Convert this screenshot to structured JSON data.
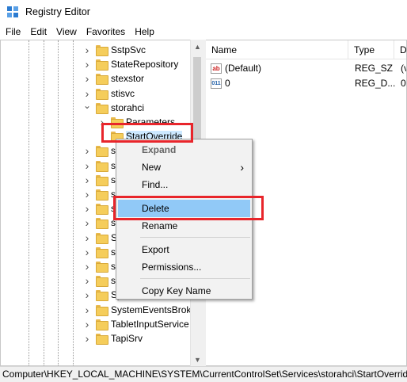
{
  "window": {
    "title": "Registry Editor"
  },
  "menu": [
    "File",
    "Edit",
    "View",
    "Favorites",
    "Help"
  ],
  "tree": {
    "items": [
      {
        "label": "SstpSvc",
        "expander": "right"
      },
      {
        "label": "StateRepository",
        "expander": "right"
      },
      {
        "label": "stexstor",
        "expander": "right"
      },
      {
        "label": "stisvc",
        "expander": "right"
      },
      {
        "label": "storahci",
        "expander": "down"
      },
      {
        "label": "Parameters",
        "expander": "right",
        "child": true
      },
      {
        "label": "StartOverride",
        "expander": "",
        "child": true,
        "selected": true
      },
      {
        "label": "s",
        "expander": "right"
      },
      {
        "label": "s",
        "expander": "right"
      },
      {
        "label": "s",
        "expander": "right"
      },
      {
        "label": "s",
        "expander": "right"
      },
      {
        "label": "s",
        "expander": "right"
      },
      {
        "label": "s",
        "expander": "right"
      },
      {
        "label": "S",
        "expander": "right"
      },
      {
        "label": "s",
        "expander": "right"
      },
      {
        "label": "s",
        "expander": "right"
      },
      {
        "label": "s",
        "expander": "right"
      },
      {
        "label": "SysMain",
        "expander": "right"
      },
      {
        "label": "SystemEventsBrok",
        "expander": "right"
      },
      {
        "label": "TabletInputService",
        "expander": "right"
      },
      {
        "label": "TapiSrv",
        "expander": "right"
      }
    ]
  },
  "list": {
    "columns": [
      "Name",
      "Type",
      "D"
    ],
    "rows": [
      {
        "icon": "ab",
        "name": "(Default)",
        "type": "REG_SZ",
        "data": "(v"
      },
      {
        "icon": "011",
        "name": "0",
        "type": "REG_D...",
        "data": "0"
      }
    ]
  },
  "context_menu": {
    "items": [
      {
        "label": "Expand",
        "bold": true
      },
      {
        "label": "New",
        "submenu": true
      },
      {
        "label": "Find..."
      },
      {
        "separator": true
      },
      {
        "label": "Delete",
        "highlighted": true
      },
      {
        "label": "Rename"
      },
      {
        "separator": true
      },
      {
        "label": "Export"
      },
      {
        "label": "Permissions..."
      },
      {
        "separator": true
      },
      {
        "label": "Copy Key Name"
      }
    ]
  },
  "status_bar": {
    "path": "Computer\\HKEY_LOCAL_MACHINE\\SYSTEM\\CurrentControlSet\\Services\\storahci\\StartOverride"
  },
  "colors": {
    "annotation": "#e8252b",
    "highlight": "#91c9f7",
    "folder": "#f5cd5b"
  },
  "icons": {
    "app": "registry-editor-icon",
    "folder": "folder-icon",
    "expand_right": "chevron-right-icon",
    "expand_down": "chevron-down-icon",
    "string_value": "string-value-icon",
    "dword_value": "dword-value-icon",
    "submenu": "chevron-right-icon"
  }
}
